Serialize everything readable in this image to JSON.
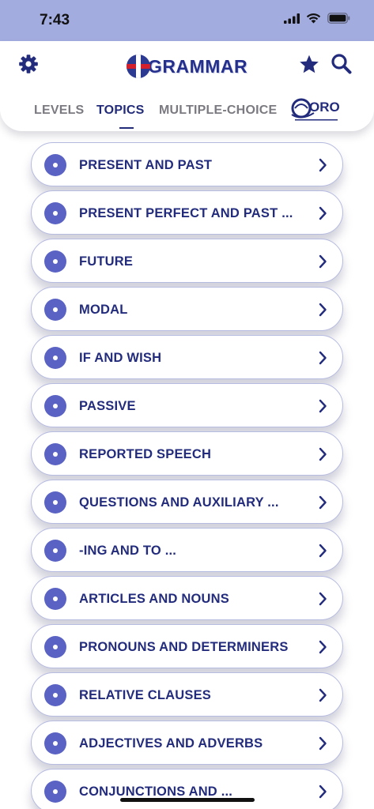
{
  "status_bar": {
    "time": "7:43"
  },
  "header": {
    "logo_text": "GRAMMAR",
    "tabs": [
      {
        "label": "LEVELS"
      },
      {
        "label": "TOPICS",
        "active": true
      },
      {
        "label": "MULTIPLE-CHOICE"
      }
    ],
    "partner_logo_text": "ORO"
  },
  "colors": {
    "accent": "#232c7c",
    "dot": "#5a63c3",
    "status_bar": "#a3acdf"
  },
  "topics": [
    {
      "label": "PRESENT AND PAST"
    },
    {
      "label": "PRESENT PERFECT AND PAST ..."
    },
    {
      "label": "FUTURE"
    },
    {
      "label": "MODAL"
    },
    {
      "label": "IF AND WISH"
    },
    {
      "label": "PASSIVE"
    },
    {
      "label": "REPORTED SPEECH"
    },
    {
      "label": "QUESTIONS AND AUXILIARY ..."
    },
    {
      "label": "-ING AND TO ..."
    },
    {
      "label": "ARTICLES AND NOUNS"
    },
    {
      "label": "PRONOUNS AND DETERMINERS"
    },
    {
      "label": "RELATIVE CLAUSES"
    },
    {
      "label": "ADJECTIVES AND ADVERBS"
    },
    {
      "label": "CONJUNCTIONS AND ..."
    }
  ]
}
